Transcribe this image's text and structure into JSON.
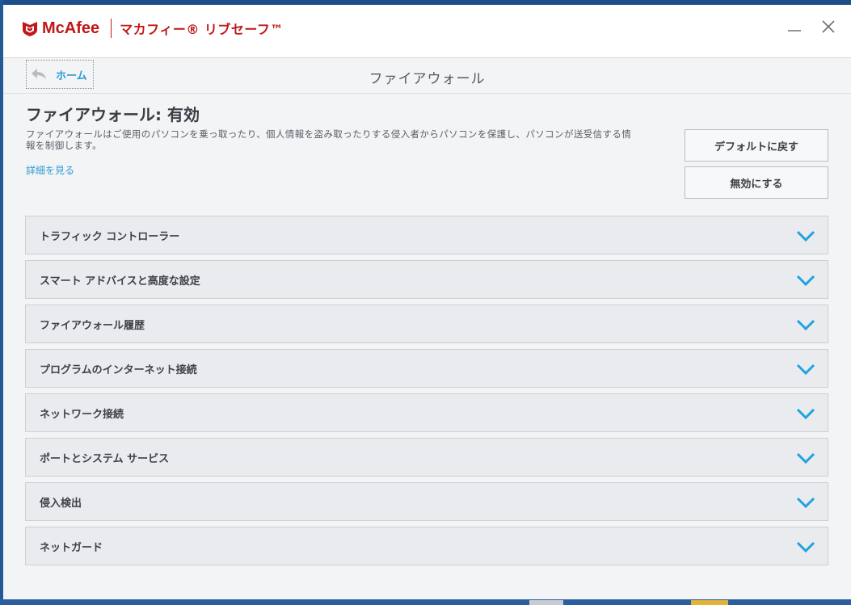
{
  "window": {
    "brand_name": "McAfee",
    "product_name": "マカフィー® リブセーフ™"
  },
  "nav": {
    "home_label": "ホーム",
    "page_title": "ファイアウォール"
  },
  "firewall": {
    "status_heading": "ファイアウォール: 有効",
    "description": "ファイアウォールはご使用のパソコンを乗っ取ったり、個人情報を盗み取ったりする侵入者からパソコンを保護し、パソコンが送受信する情報を制御します。",
    "more_link": "詳細を見る",
    "restore_default_label": "デフォルトに戻す",
    "disable_label": "無効にする"
  },
  "sections": [
    {
      "label": "トラフィック コントローラー"
    },
    {
      "label": "スマート アドバイスと高度な設定"
    },
    {
      "label": "ファイアウォール履歴"
    },
    {
      "label": "プログラムのインターネット接続"
    },
    {
      "label": "ネットワーク接続"
    },
    {
      "label": "ポートとシステム サービス"
    },
    {
      "label": "侵入検出"
    },
    {
      "label": "ネットガード"
    }
  ],
  "colors": {
    "brand_red": "#c01818",
    "link_blue": "#2f9bd0",
    "chevron_blue": "#1fa3e0"
  },
  "icons": {
    "brand": "mcafee-shield-icon",
    "back": "back-arrow-icon",
    "minimize": "minimize-icon",
    "close": "close-icon",
    "expand": "chevron-down-icon"
  }
}
